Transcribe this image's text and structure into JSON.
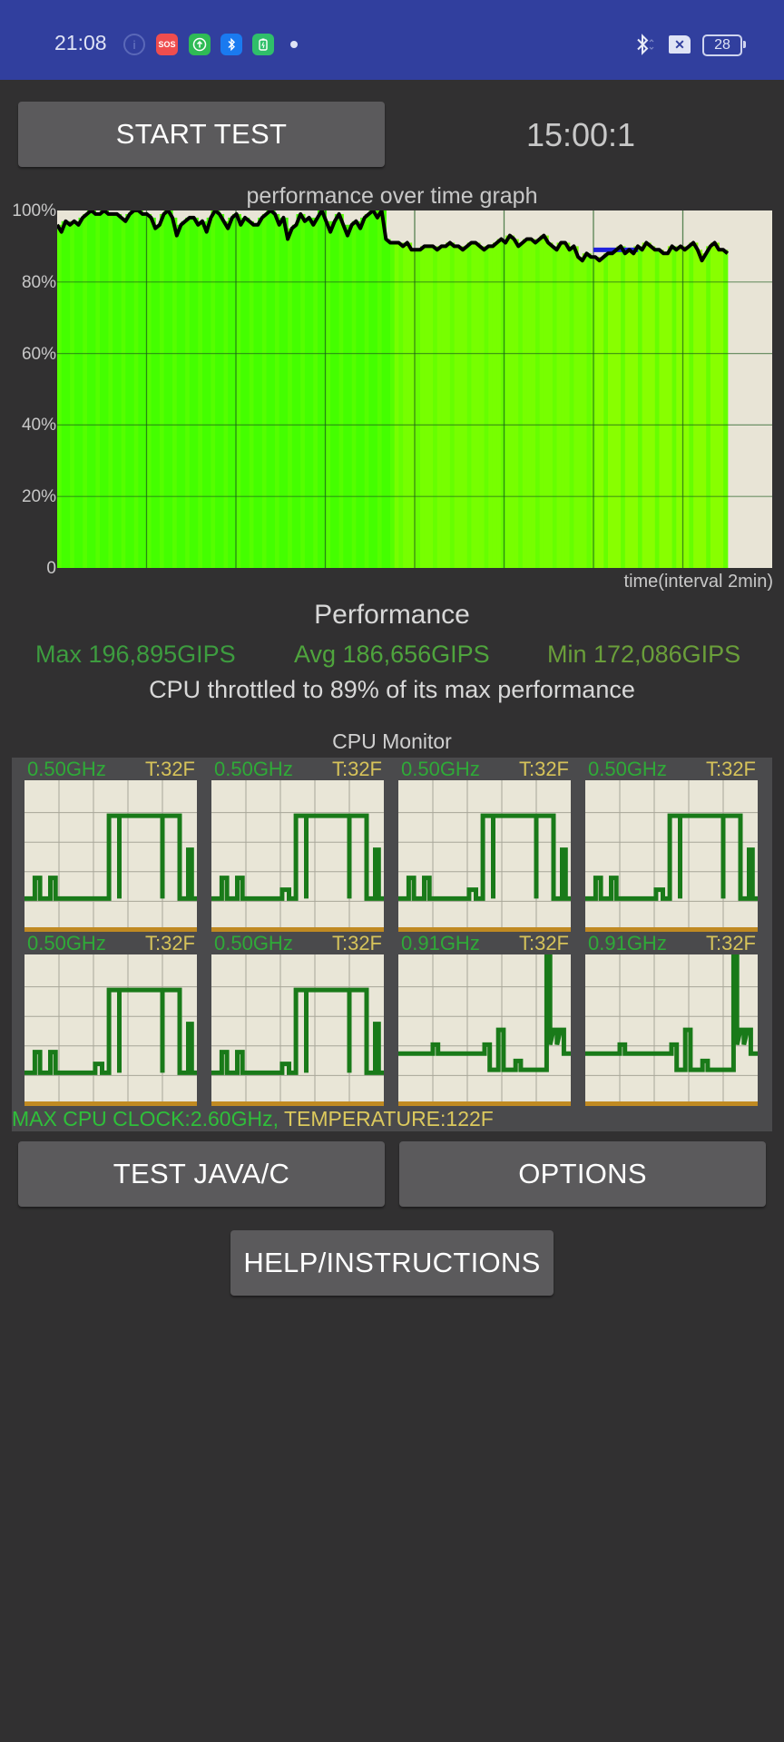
{
  "status_bar": {
    "time": "21:08",
    "icons": [
      "info-icon",
      "sos-icon",
      "upload-icon",
      "bluetooth-icon",
      "battery-saver-icon",
      "dot-icon"
    ],
    "sos_label": "SOS",
    "battery_level": "28",
    "colors": {
      "background": "#313f9e",
      "sos": "#ef4d4e",
      "upload": "#2fbb55",
      "bluetooth": "#1a7af0",
      "battery_saver": "#2fbf6a"
    }
  },
  "controls": {
    "start_test_label": "START TEST",
    "timer": "15:00:1",
    "test_java_label": "TEST JAVA/C",
    "options_label": "OPTIONS",
    "help_label": "HELP/INSTRUCTIONS"
  },
  "chart_data": {
    "type": "area",
    "title": "performance over time graph",
    "xlabel": "time(interval 2min)",
    "ylabel": "",
    "y_ticks": [
      "0",
      "20%",
      "40%",
      "60%",
      "80%",
      "100%"
    ],
    "ylim": [
      0,
      100
    ],
    "x_interval_minutes": 2,
    "x_range_minutes": [
      0,
      16
    ],
    "grid": true,
    "elapsed_minutes": 15,
    "series": [
      {
        "name": "performance",
        "color": "#000000",
        "values": [
          96,
          94,
          97,
          96,
          97,
          96,
          98,
          99,
          100,
          99,
          99,
          100,
          99,
          99,
          99,
          98,
          97,
          99,
          100,
          100,
          99,
          99,
          98,
          95,
          96,
          99,
          100,
          98,
          93,
          96,
          97,
          98,
          98,
          96,
          97,
          94,
          98,
          100,
          99,
          97,
          95,
          98,
          99,
          96,
          98,
          97,
          96,
          96,
          98,
          99,
          100,
          99,
          96,
          98,
          92,
          95,
          96,
          99,
          97,
          98,
          96,
          98,
          100,
          97,
          94,
          97,
          99,
          96,
          93,
          96,
          97,
          95,
          98,
          99,
          100,
          98,
          100,
          92,
          91,
          91,
          91,
          90,
          91,
          89,
          89,
          89,
          90,
          90,
          90,
          89,
          90,
          90,
          91,
          90,
          90,
          89,
          90,
          91,
          91,
          90,
          89,
          90,
          90,
          91,
          92,
          91,
          93,
          92,
          90,
          91,
          92,
          92,
          91,
          92,
          93,
          91,
          90,
          89,
          91,
          91,
          89,
          90,
          87,
          86,
          88,
          87,
          87,
          86,
          87,
          88,
          88,
          89,
          90,
          88,
          89,
          88,
          90,
          89,
          91,
          90,
          89,
          89,
          88,
          88,
          90,
          89,
          90,
          89,
          90,
          91,
          89,
          86,
          88,
          90,
          91,
          89,
          89,
          88
        ]
      },
      {
        "name": "throttle-marker",
        "color": "#2222dd",
        "value": 89,
        "x_range_minutes": [
          12.0,
          13.0
        ]
      }
    ],
    "fill_colors": [
      "#44ff00",
      "#55ff00",
      "#66ff00",
      "#77ff00",
      "#88ff00"
    ]
  },
  "performance": {
    "heading": "Performance",
    "max": "Max 196,895GIPS",
    "avg": "Avg 186,656GIPS",
    "min": "Min 172,086GIPS",
    "throttle_text": "CPU throttled to 89% of its max performance",
    "colors": {
      "max": "#3d9c3f",
      "avg": "#4fa43d",
      "min": "#6a9e3a"
    }
  },
  "cpu_monitor": {
    "title": "CPU Monitor",
    "cores": [
      {
        "freq": "0.50GHz",
        "temp": "T:32F",
        "pattern": "a"
      },
      {
        "freq": "0.50GHz",
        "temp": "T:32F",
        "pattern": "b"
      },
      {
        "freq": "0.50GHz",
        "temp": "T:32F",
        "pattern": "b"
      },
      {
        "freq": "0.50GHz",
        "temp": "T:32F",
        "pattern": "b"
      },
      {
        "freq": "0.50GHz",
        "temp": "T:32F",
        "pattern": "b"
      },
      {
        "freq": "0.50GHz",
        "temp": "T:32F",
        "pattern": "b"
      },
      {
        "freq": "0.91GHz",
        "temp": "T:32F",
        "pattern": "c"
      },
      {
        "freq": "0.91GHz",
        "temp": "T:32F",
        "pattern": "c"
      }
    ],
    "max_clock_label": "MAX CPU CLOCK:2.60GHz,",
    "temperature_label": " TEMPERATURE:122F"
  }
}
